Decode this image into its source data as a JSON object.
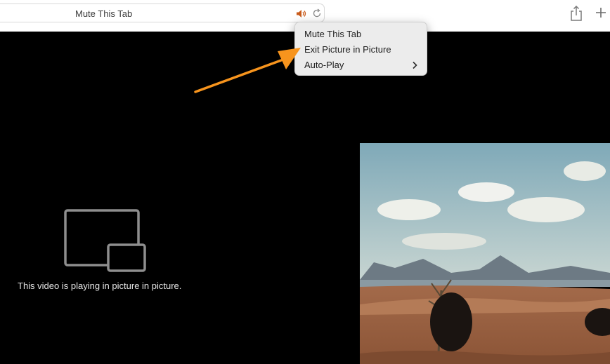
{
  "toolbar": {
    "address_text": "Mute This Tab",
    "icons": [
      "speaker-icon",
      "reload-icon",
      "share-icon",
      "plus-icon"
    ]
  },
  "context_menu": {
    "items": [
      {
        "label": "Mute This Tab"
      },
      {
        "label": "Exit Picture in Picture"
      },
      {
        "label": "Auto-Play",
        "has_submenu": true
      }
    ]
  },
  "content": {
    "pip_message": "This video is playing in picture in picture."
  },
  "colors": {
    "accent_arrow": "#f7941d",
    "speaker_active": "#c85a1a",
    "background": "#000000"
  }
}
